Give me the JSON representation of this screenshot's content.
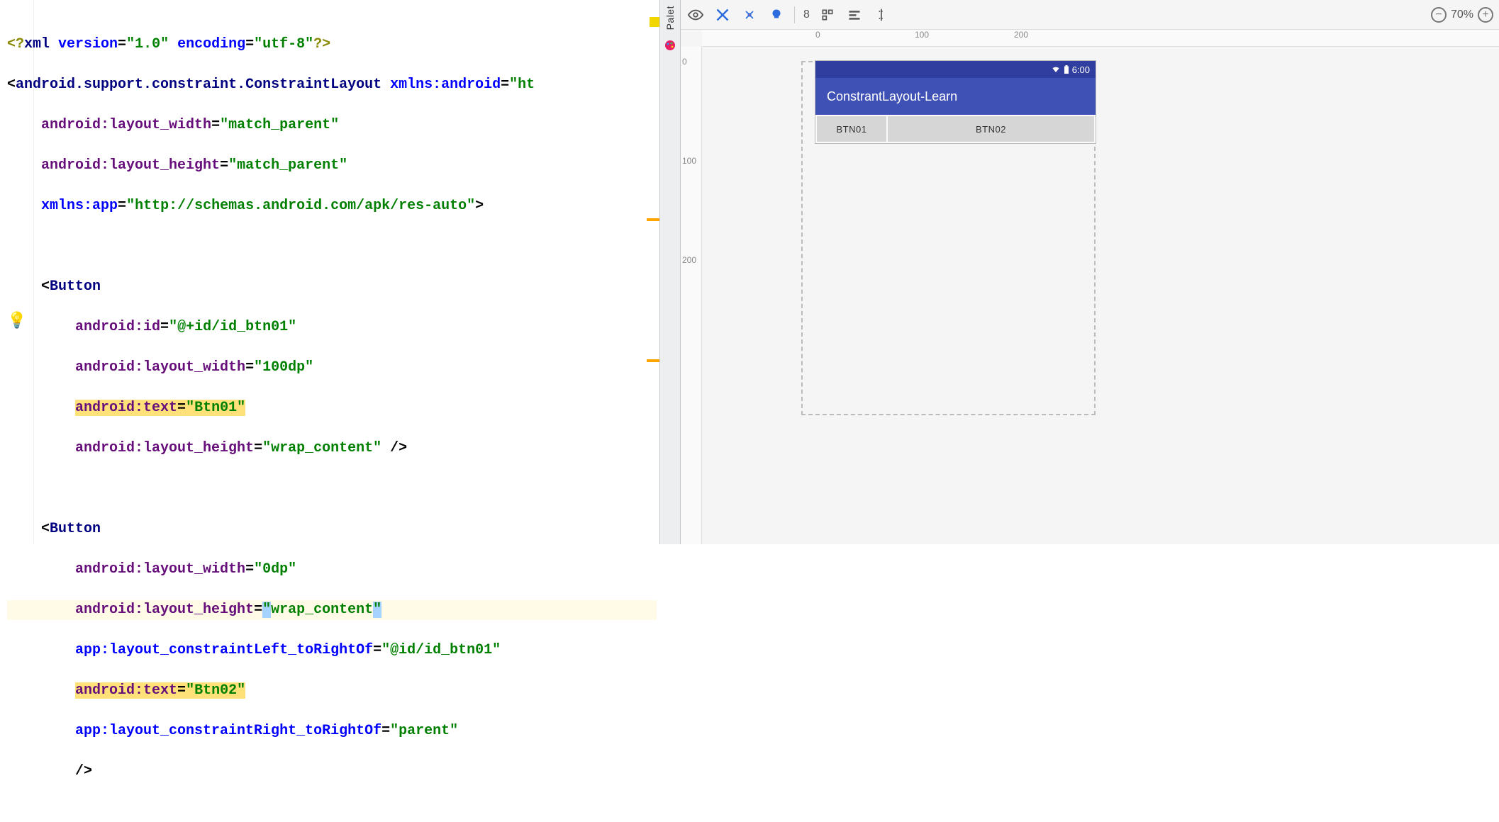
{
  "editor": {
    "lines": {
      "l1a": "<?",
      "l1b": "xml ",
      "l1c_attr": "version",
      "l1c_eq": "=",
      "l1c_val": "\"1.0\"",
      "l1d_sp": " ",
      "l1d_attr": "encoding",
      "l1d_eq": "=",
      "l1d_val": "\"utf-8\"",
      "l1e": "?>",
      "l2a": "<",
      "l2b": "android.support.constraint.ConstraintLayout ",
      "l2c_attr": "xmlns:android",
      "l2c_eq": "=",
      "l2c_val": "\"ht",
      "l3_attr": "android:layout_width",
      "l3_eq": "=",
      "l3_val": "\"match_parent\"",
      "l4_attr": "android:layout_height",
      "l4_eq": "=",
      "l4_val": "\"match_parent\"",
      "l5_attr": "xmlns:app",
      "l5_eq": "=",
      "l5_val": "\"http://schemas.android.com/apk/res-auto\"",
      "l5_end": ">",
      "l7a": "<",
      "l7b": "Button",
      "l8_attr": "android:id",
      "l8_eq": "=",
      "l8_val": "\"@+id/id_btn01\"",
      "l9_attr": "android:layout_width",
      "l9_eq": "=",
      "l9_val": "\"100dp\"",
      "l10_attr": "android:text",
      "l10_eq": "=",
      "l10_val": "\"Btn01\"",
      "l11_attr": "android:layout_height",
      "l11_eq": "=",
      "l11_val": "\"wrap_content\"",
      "l11_end": " />",
      "l13a": "<",
      "l13b": "Button",
      "l14_attr": "android:layout_width",
      "l14_eq": "=",
      "l14_val": "\"0dp\"",
      "l15_attr": "android:layout_height",
      "l15_eq": "=",
      "l15_q1": "\"",
      "l15_val": "wrap_content",
      "l15_q2": "\"",
      "l16_attr": "app:layout_constraintLeft_toRightOf",
      "l16_eq": "=",
      "l16_val": "\"@id/id_btn01\"",
      "l17_attr": "android:text",
      "l17_eq": "=",
      "l17_val": "\"Btn02\"",
      "l18_attr": "app:layout_constraintRight_toRightOf",
      "l18_eq": "=",
      "l18_val": "\"parent\"",
      "l19": "/>"
    },
    "indent1": "    ",
    "indent2": "        "
  },
  "palette": {
    "label": "Palet"
  },
  "design_toolbar": {
    "api_num": "8",
    "zoom_label": "70%"
  },
  "ruler_h": {
    "t0": "0",
    "t100": "100",
    "t200": "200"
  },
  "ruler_v": {
    "t0": "0",
    "t100": "100",
    "t200": "200"
  },
  "device": {
    "status_time": "6:00",
    "app_title": "ConstrantLayout-Learn",
    "btn1": "BTN01",
    "btn2": "BTN02"
  }
}
